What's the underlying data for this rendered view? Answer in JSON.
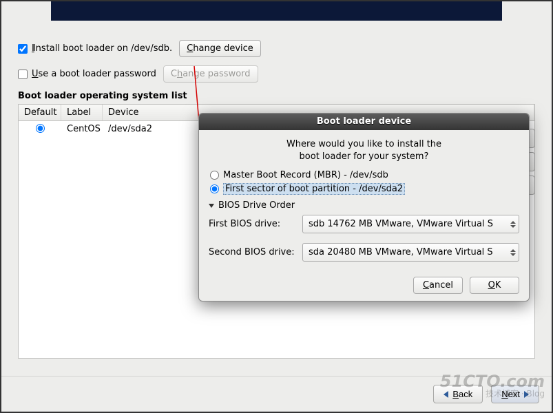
{
  "main": {
    "install_checkbox_label": "Install boot loader on /dev/sdb.",
    "change_device_btn": "Change device",
    "use_password_label": "Use a boot loader password",
    "change_password_btn": "Change password",
    "section_heading": "Boot loader operating system list",
    "columns": {
      "default": "Default",
      "label": "Label",
      "device": "Device"
    },
    "rows": [
      {
        "default": true,
        "label": "CentOS",
        "device": "/dev/sda2"
      }
    ],
    "back_btn": "Back",
    "next_btn": "Next"
  },
  "dialog": {
    "title": "Boot loader device",
    "prompt_line1": "Where would you like to install the",
    "prompt_line2": "boot loader for your system?",
    "radio_mbr": "Master Boot Record (MBR) - /dev/sdb",
    "radio_firstsector": "First sector of boot partition - /dev/sda2",
    "expander": "BIOS Drive Order",
    "first_label": "First BIOS drive:",
    "second_label": "Second BIOS drive:",
    "first_value": "sdb   14762 MB VMware, VMware Virtual S",
    "second_value": "sda   20480 MB VMware, VMware Virtual S",
    "cancel": "Cancel",
    "ok": "OK"
  },
  "watermark": {
    "big": "51CTO.com",
    "small": "技术博客 · Blog"
  }
}
